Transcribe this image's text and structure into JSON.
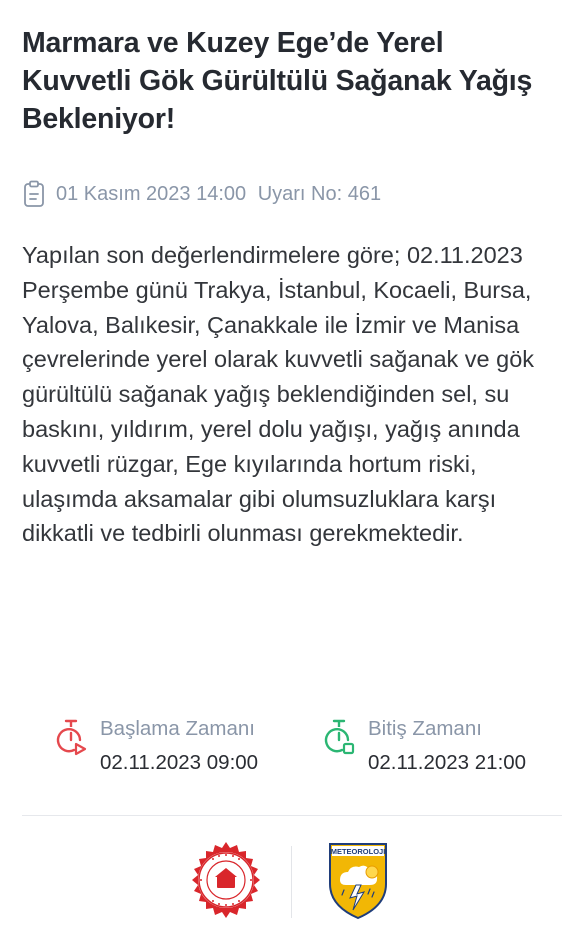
{
  "alert": {
    "title": "Marmara ve Kuzey Ege’de Yerel Kuvvetli Gök Gürültülü Sağanak Yağış Bekleniyor!",
    "date": "01 Kasım 2023 14:00",
    "warning_no": "Uyarı No: 461",
    "body": "Yapılan son değerlendirmelere göre; 02.11.2023 Perşembe günü Trakya, İstanbul, Kocaeli, Bursa, Yalova, Balıkesir, Çanakkale ile İzmir ve Manisa çevrelerinde yerel olarak kuvvetli sağanak ve gök gürültülü sağanak yağış beklendiğinden sel, su baskını, yıldırım, yerel dolu yağışı, yağış anında kuvvetli rüzgar, Ege kıyılarında hortum riski, ulaşımda aksamalar gibi olumsuzluklara karşı dikkatli ve tedbirli olunması gerekmektedir."
  },
  "times": {
    "start": {
      "label": "Başlama Zamanı",
      "value": "02.11.2023 09:00",
      "icon": "stopwatch-play-icon",
      "color": "#e5484d"
    },
    "end": {
      "label": "Bitiş Zamanı",
      "value": "02.11.2023 21:00",
      "icon": "stopwatch-stop-icon",
      "color": "#2bb673"
    }
  },
  "logos": {
    "afad": {
      "icon": "afad-seal-logo",
      "color": "#d9262b"
    },
    "meteoroloji": {
      "text": "METEOROLOJI",
      "icon": "meteoroloji-shield-logo",
      "color": "#f2b705"
    }
  },
  "colors": {
    "title": "#262a31",
    "muted": "#8a96a8",
    "body": "#33363b"
  }
}
